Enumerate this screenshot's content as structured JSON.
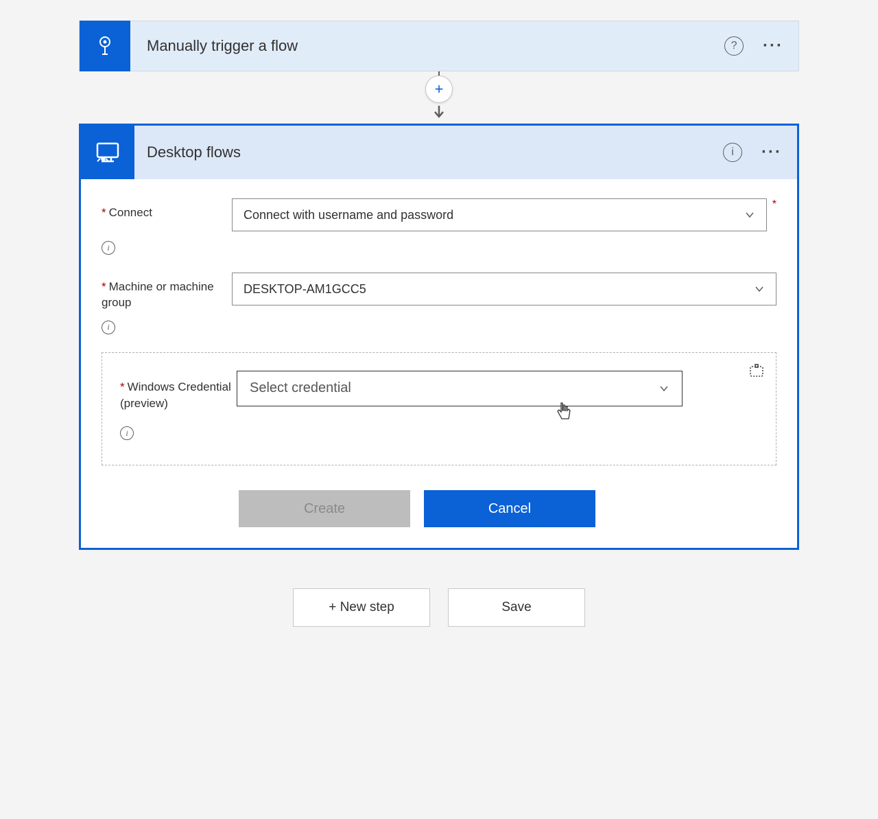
{
  "trigger": {
    "title": "Manually trigger a flow"
  },
  "action": {
    "title": "Desktop flows",
    "fields": {
      "connect_label": "Connect",
      "connect_value": "Connect with username and password",
      "machine_label": "Machine or machine group",
      "machine_value": "DESKTOP-AM1GCC5",
      "credential_label": "Windows Credential (preview)",
      "credential_placeholder": "Select credential"
    },
    "buttons": {
      "create": "Create",
      "cancel": "Cancel"
    }
  },
  "bottom": {
    "new_step": "+ New step",
    "save": "Save"
  },
  "glyphs": {
    "asterisk": "*",
    "question": "?",
    "info_i": "i"
  }
}
